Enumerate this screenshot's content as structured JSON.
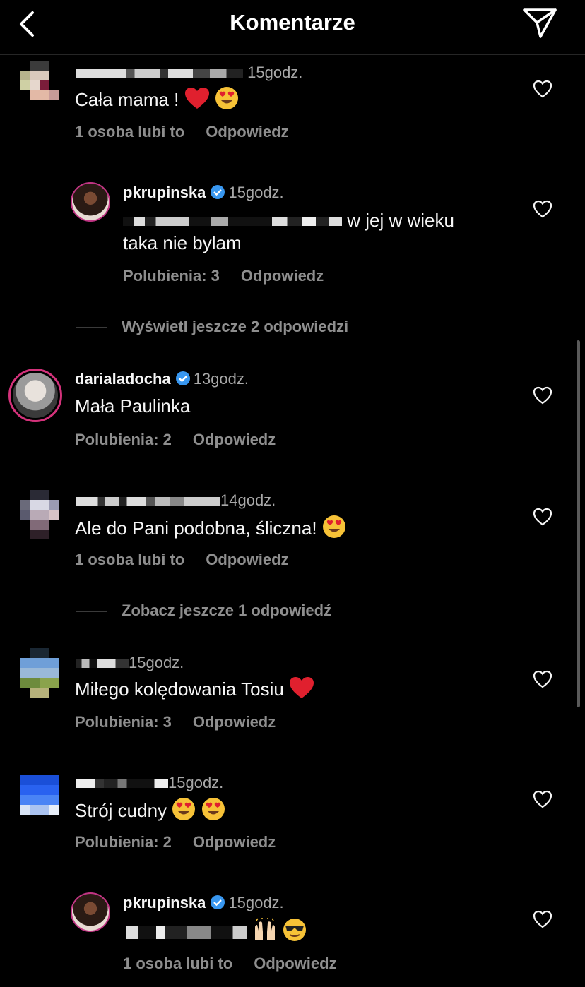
{
  "header": {
    "title": "Komentarze",
    "back_icon": "chevron-left-icon",
    "send_icon": "paper-plane-icon"
  },
  "colors": {
    "background": "#000000",
    "text": "#f5f5f5",
    "secondary": "#8e8e8e",
    "verified": "#3897f0",
    "heart_emoji": "#e0202e"
  },
  "comments": [
    {
      "username": "",
      "time": "15godz.",
      "text": "Cała mama !",
      "likes": "1 osoba lubi to",
      "reply": "Odpowiedz"
    },
    {
      "username": "pkrupinska",
      "time": "15godz.",
      "text_1": "w jej w wieku",
      "text_2": "taka nie bylam",
      "likes": "Polubienia: 3",
      "reply": "Odpowiedz"
    },
    {
      "username": "darialadocha",
      "time": "13godz.",
      "text": "Mała Paulinka",
      "likes": "Polubienia: 2",
      "reply": "Odpowiedz"
    },
    {
      "username": "",
      "time": "14godz.",
      "text": "Ale do Pani podobna, śliczna!",
      "likes": "1 osoba lubi to",
      "reply": "Odpowiedz"
    },
    {
      "username": "",
      "time": "15godz.",
      "text": "Miłego kolędowania Tosiu",
      "likes": "Polubienia: 3",
      "reply": "Odpowiedz"
    },
    {
      "username": "",
      "time": "15godz.",
      "text": "Strój cudny",
      "likes": "Polubienia: 2",
      "reply": "Odpowiedz"
    },
    {
      "username": "pkrupinska",
      "time": "15godz.",
      "text": "",
      "likes": "1 osoba lubi to",
      "reply": "Odpowiedz"
    }
  ],
  "view_more": [
    "Wyświetl jeszcze 2 odpowiedzi",
    "Zobacz jeszcze 1 odpowiedź"
  ]
}
